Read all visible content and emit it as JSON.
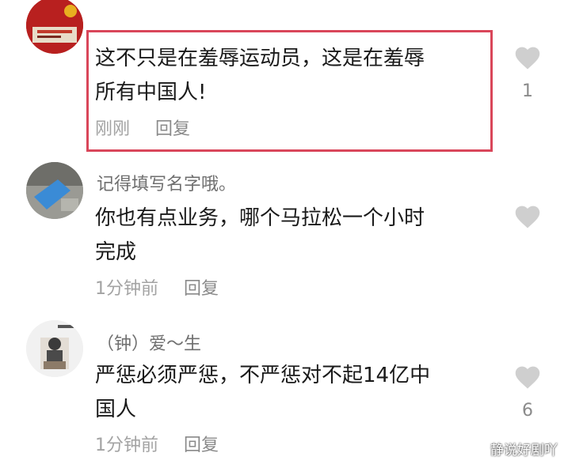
{
  "comments": [
    {
      "username": "",
      "text_line1": "这不只是在羞辱运动员，这是在羞辱",
      "text_line2": "所有中国人!",
      "time": "刚刚",
      "reply": "回复",
      "likes": "1"
    },
    {
      "username": "记得填写名字哦。",
      "text_line1": "你也有点业务，哪个马拉松一个小时",
      "text_line2": "完成",
      "time": "1分钟前",
      "reply": "回复",
      "likes": ""
    },
    {
      "username": "（钟）爱～生",
      "text_line1": "严惩必须严惩，不严惩对不起14亿中",
      "text_line2": "国人",
      "time": "1分钟前",
      "reply": "回复",
      "likes": "6"
    }
  ],
  "highlight_color": "#d9465a",
  "like_icon": "heart-icon",
  "watermark": "静说好剧吖"
}
